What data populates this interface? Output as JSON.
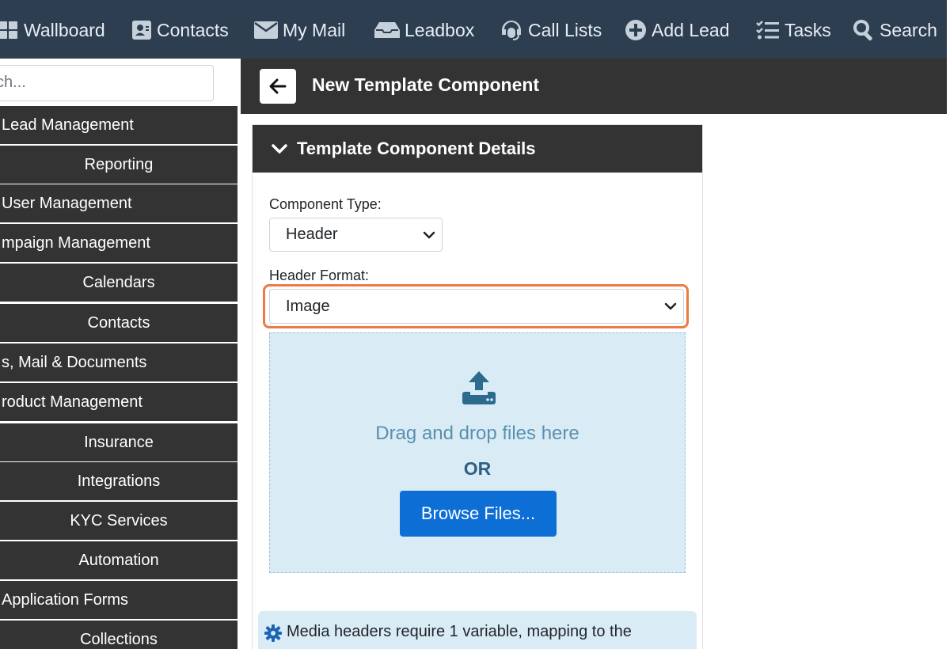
{
  "topnav": {
    "items": [
      {
        "label": "Wallboard",
        "icon": "grid-icon"
      },
      {
        "label": "Contacts",
        "icon": "contact-card-icon"
      },
      {
        "label": "My Mail",
        "icon": "envelope-icon"
      },
      {
        "label": "Leadbox",
        "icon": "inbox-icon"
      },
      {
        "label": "Call Lists",
        "icon": "headset-icon"
      },
      {
        "label": "Add Lead",
        "icon": "plus-circle-icon"
      },
      {
        "label": "Tasks",
        "icon": "tasks-icon"
      },
      {
        "label": "Search",
        "icon": "search-icon"
      }
    ]
  },
  "sidebar": {
    "search_text": "ch...",
    "items": [
      {
        "label": "Lead Management",
        "kind": "main"
      },
      {
        "label": "Reporting",
        "kind": "sub"
      },
      {
        "label": "User Management",
        "kind": "main"
      },
      {
        "label": "mpaign Management",
        "kind": "main"
      },
      {
        "label": "Calendars",
        "kind": "sub"
      },
      {
        "label": "Contacts",
        "kind": "sub"
      },
      {
        "label": "s, Mail & Documents",
        "kind": "main"
      },
      {
        "label": "roduct Management",
        "kind": "main"
      },
      {
        "label": "Insurance",
        "kind": "sub"
      },
      {
        "label": "Integrations",
        "kind": "sub"
      },
      {
        "label": "KYC Services",
        "kind": "sub"
      },
      {
        "label": "Automation",
        "kind": "sub"
      },
      {
        "label": "Application Forms",
        "kind": "main"
      },
      {
        "label": "Collections",
        "kind": "sub"
      }
    ]
  },
  "header": {
    "title": "New Template Component"
  },
  "card": {
    "title": "Template Component Details",
    "component_type_label": "Component Type:",
    "component_type_value": "Header",
    "header_format_label": "Header Format:",
    "header_format_value": "Image",
    "dropzone": {
      "text": "Drag and drop files here",
      "or": "OR",
      "browse_label": "Browse Files..."
    },
    "info_text": "Media headers require 1 variable, mapping to the"
  },
  "colors": {
    "nav_bg": "#2c3e50",
    "dark_panel": "#333333",
    "highlight": "#ee7a45",
    "dropzone_bg": "#d9ecf6",
    "primary_button": "#0d6fd6"
  }
}
